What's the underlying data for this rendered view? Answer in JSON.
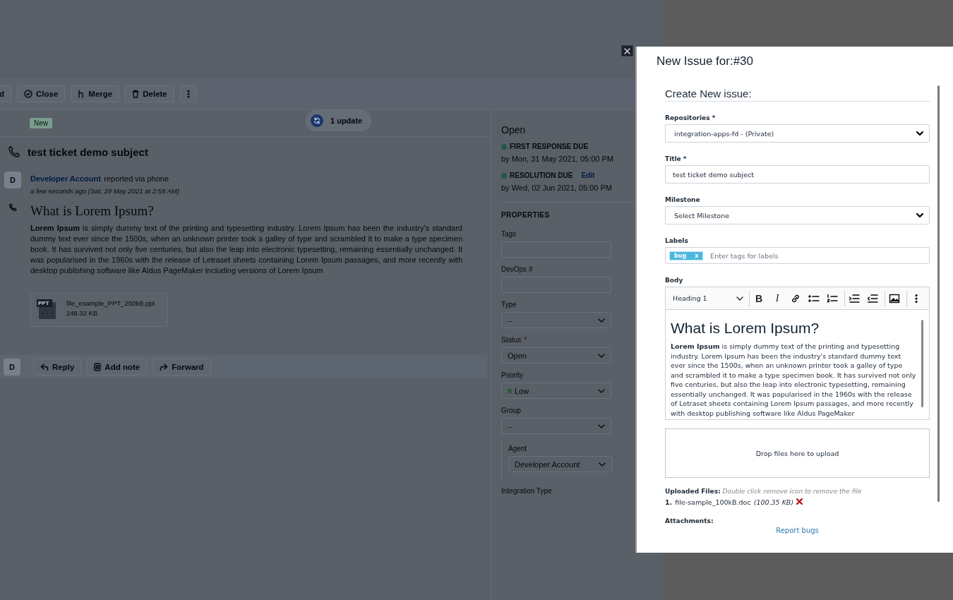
{
  "toolbar": {
    "buttons": [
      {
        "kind": "forward",
        "label": "d"
      },
      {
        "kind": "close",
        "label": "Close"
      },
      {
        "kind": "merge",
        "label": "Merge"
      },
      {
        "kind": "delete",
        "label": "Delete"
      },
      {
        "kind": "more"
      }
    ]
  },
  "update_pill": {
    "label": "1 update"
  },
  "ticket": {
    "status_badge": "New",
    "subject": "test ticket demo subject",
    "avatar": "D",
    "author": "Developer Account",
    "via": "reported via phone",
    "timestamp": "a few seconds ago (Sat, 29 May 2021 at 2:58 AM)",
    "heading": "What is Lorem Ipsum?",
    "body": "**Lorem Ipsum** is simply dummy text of the printing and typesetting industry. Lorem Ipsum has been the industry's standard dummy text ever since the 1500s, when an unknown printer took a galley of type and scrambled it to make a type specimen book. It has survived not only five centuries, but also the leap into electronic typesetting, remaining essentially unchanged. It was popularised in the 1960s with the release of Letraset sheets containing Lorem Ipsum passages, and more recently with desktop publishing software like Aldus PageMaker including versions of Lorem Ipsum",
    "attachment": {
      "type": "PPT",
      "name": "file_example_PPT_250kB.ppt",
      "size": "248.32 KB"
    }
  },
  "reply_bar": {
    "avatar": "D",
    "buttons": [
      {
        "kind": "reply",
        "label": "Reply"
      },
      {
        "kind": "note",
        "label": "Add note"
      },
      {
        "kind": "forward",
        "label": "Forward"
      }
    ]
  },
  "sidebar": {
    "status": "Open",
    "sla": [
      {
        "label": "FIRST RESPONSE DUE",
        "due": "by Mon, 31 May 2021, 05:00 PM",
        "color": "#1d5a45"
      },
      {
        "label": "RESOLUTION DUE",
        "action": "Edit",
        "due": "by Wed, 02 Jun 2021, 05:00 PM",
        "color": "#1d5a45"
      }
    ],
    "properties_title": "PROPERTIES",
    "fields": [
      {
        "kind": "input",
        "label": "Tags"
      },
      {
        "kind": "input",
        "label": "DevOps #"
      },
      {
        "kind": "select",
        "label": "Type",
        "value": "--"
      },
      {
        "kind": "select",
        "label": "Status",
        "required_mark": "*",
        "value": "Open"
      },
      {
        "kind": "select",
        "label": "Priority",
        "value": "Low",
        "color": "#2f5a3a"
      },
      {
        "kind": "select",
        "label": "Group",
        "value": "--"
      },
      {
        "kind": "select",
        "label": "Agent",
        "value": "Developer Account",
        "indented": true
      },
      {
        "kind": "label",
        "label": "Integration Type"
      }
    ]
  },
  "modal": {
    "title": "New Issue for:#30",
    "heading": "Create New issue:",
    "fields": [
      {
        "kind": "select",
        "label": "Repositories *",
        "value": "integration-apps-fd - (Private)"
      },
      {
        "kind": "input",
        "label": "Title *",
        "value": "test ticket demo subject"
      },
      {
        "kind": "select",
        "label": "Milestone",
        "value": "Select Milestone"
      },
      {
        "kind": "tags",
        "label": "Labels",
        "tags": [
          {
            "label": "bug",
            "remove": "x"
          }
        ],
        "placeholder": "Enter tags for labels"
      },
      {
        "kind": "editor",
        "label": "Body",
        "block_style": "Heading 1",
        "tools": [
          {
            "kind": "bold",
            "label": "B"
          },
          {
            "kind": "italic",
            "label": "I"
          },
          {
            "kind": "link"
          },
          {
            "kind": "bullets"
          },
          {
            "kind": "numbers"
          },
          {
            "kind": "indent"
          },
          {
            "kind": "outdent"
          },
          {
            "kind": "image"
          },
          {
            "kind": "more"
          }
        ],
        "heading": "What is Lorem Ipsum?",
        "body": "**Lorem Ipsum** is simply dummy text of the printing and typesetting industry. Lorem Ipsum has been the industry's standard dummy text ever since the 1500s, when an unknown printer took a galley of type and scrambled it to make a type specimen book. It has survived not only five centuries, but also the leap into electronic typesetting, remaining essentially unchanged. It was popularised in the 1960s with the release of Letraset sheets containing Lorem Ipsum passages, and more recently with desktop publishing software like Aldus PageMaker"
      }
    ],
    "dropzone": "Drop files here to upload",
    "uploaded": {
      "label": "Uploaded Files:",
      "hint": "Double click remove icon to remove the file",
      "files": [
        {
          "index": "1.",
          "name": "file-sample_100kB.doc",
          "size": "(100.35 KB)"
        }
      ]
    },
    "attachments_label": "Attachments:",
    "report_link": "Report bugs"
  }
}
